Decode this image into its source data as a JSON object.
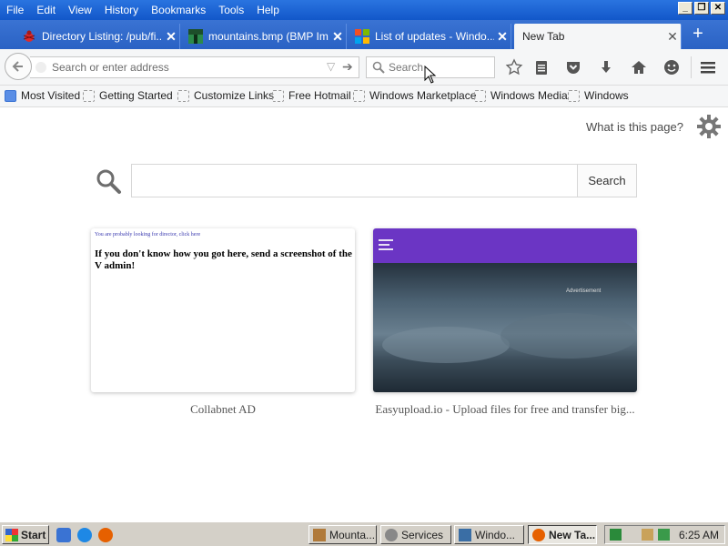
{
  "menu": {
    "items": [
      "File",
      "Edit",
      "View",
      "History",
      "Bookmarks",
      "Tools",
      "Help"
    ]
  },
  "window_controls": {
    "minimize": "_",
    "restore": "❐",
    "close": "✕"
  },
  "tabs": [
    {
      "title": "Directory Listing: /pub/fi...",
      "icon": "bug-icon",
      "color": "#e02b2b",
      "active": false
    },
    {
      "title": "mountains.bmp (BMP Im...",
      "icon": "image-icon",
      "color": "#2c8a4a",
      "active": false
    },
    {
      "title": "List of updates - Windo...",
      "icon": "windows-logo-icon",
      "color": "#f25022",
      "active": false
    },
    {
      "title": "New Tab",
      "icon": "none",
      "active": true
    }
  ],
  "tab_close_glyph": "✕",
  "new_tab_glyph": "+",
  "navbar": {
    "back_glyph": "🡐",
    "url_placeholder": "Search or enter address",
    "search_placeholder": "Search",
    "dropmarker_glyph": "▽",
    "go_glyph": "➔"
  },
  "toolbar_icons": [
    "star-icon",
    "reading-list-icon",
    "pocket-icon",
    "download-icon",
    "home-icon",
    "hello-icon",
    "menu-icon"
  ],
  "bookmarks": [
    "Most Visited",
    "Getting Started",
    "Customize Links",
    "Free Hotmail",
    "Windows Marketplace",
    "Windows Media",
    "Windows"
  ],
  "page": {
    "what_is_this": "What is this page?",
    "search_button": "Search",
    "tiles": [
      {
        "small_text": "You are probably looking for director, click here",
        "big_text": "If you don't know how you got here, send a screenshot of the V admin!",
        "label": "Collabnet AD"
      },
      {
        "ad_text": "Advertisement",
        "label": "Easyupload.io - Upload files for free and transfer big..."
      }
    ]
  },
  "taskbar": {
    "start_label": "Start",
    "tasks": [
      {
        "label": "Mounta...",
        "active": false
      },
      {
        "label": "Services",
        "active": false
      },
      {
        "label": "Windo...",
        "active": false
      },
      {
        "label": "New Ta...",
        "active": true
      }
    ],
    "clock": "6:25 AM"
  },
  "colors": {
    "titlebar": "#1257c9",
    "tabstrip": "#2a62c4",
    "toolbar": "#f5f6f7",
    "tile_purple": "#6b35c4",
    "taskbar": "#d4d0c8"
  }
}
